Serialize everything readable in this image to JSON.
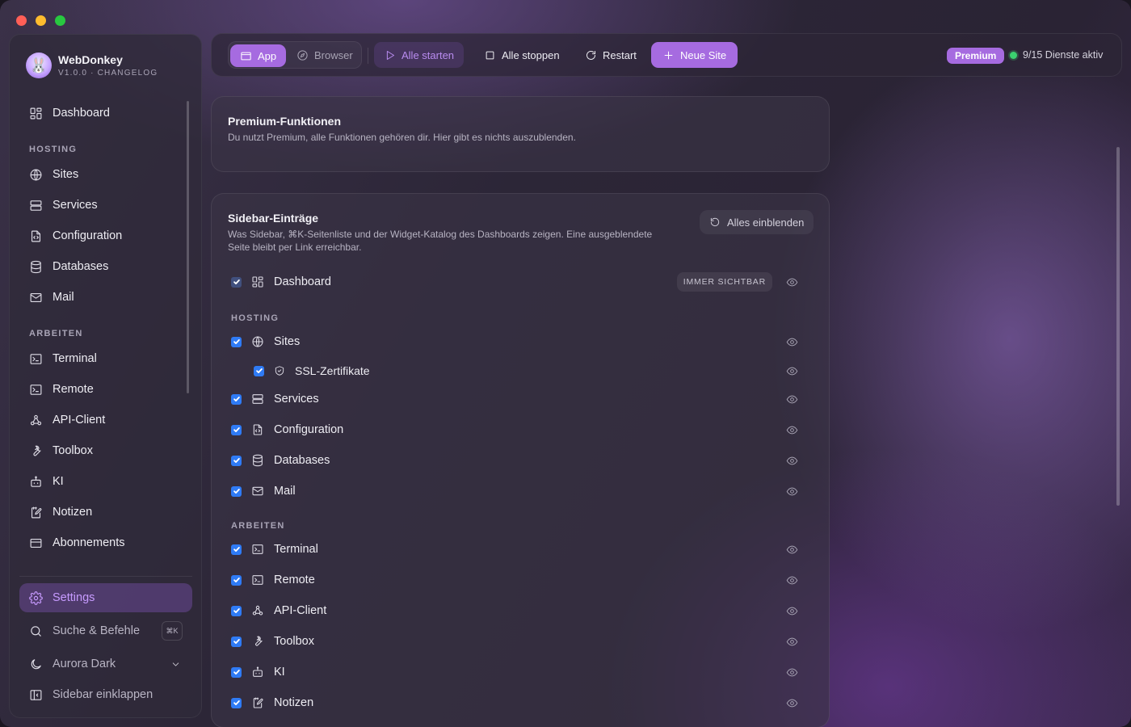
{
  "app": {
    "name": "WebDonkey",
    "version": "V1.0.0 · CHANGELOG"
  },
  "sidebar": {
    "dashboard": "Dashboard",
    "sections": {
      "hosting": "HOSTING",
      "arbeiten": "ARBEITEN"
    },
    "hosting_items": [
      "Sites",
      "Services",
      "Configuration",
      "Databases",
      "Mail"
    ],
    "arbeiten_items": [
      "Terminal",
      "Remote",
      "API-Client",
      "Toolbox",
      "KI",
      "Notizen",
      "Abonnements"
    ],
    "settings": "Settings",
    "search": "Suche & Befehle",
    "search_shortcut": "⌘K",
    "theme": "Aurora Dark",
    "collapse": "Sidebar einklappen"
  },
  "toolbar": {
    "app": "App",
    "browser": "Browser",
    "start_all": "Alle starten",
    "stop_all": "Alle stoppen",
    "restart": "Restart",
    "new_site": "Neue Site",
    "premium": "Premium",
    "status": "9/15 Dienste aktiv"
  },
  "premium_card": {
    "title": "Premium-Funktionen",
    "description": "Du nutzt Premium, alle Funktionen gehören dir. Hier gibt es nichts auszublenden."
  },
  "sidebar_card": {
    "title": "Sidebar-Einträge",
    "description_line1": "Was Sidebar, ⌘K-Seitenliste und der Widget-Katalog des Dashboards zeigen. Eine ausgeblendete",
    "description_line2": "Seite bleibt per Link erreichbar.",
    "reset_button": "Alles einblenden",
    "always_visible": "IMMER SICHTBAR",
    "dashboard": "Dashboard",
    "hosting_label": "HOSTING",
    "arbeiten_label": "ARBEITEN",
    "hosting_rows": [
      "Sites",
      "SSL-Zertifikate",
      "Services",
      "Configuration",
      "Databases",
      "Mail"
    ],
    "arbeiten_rows": [
      "Terminal",
      "Remote",
      "API-Client",
      "Toolbox",
      "KI",
      "Notizen"
    ]
  },
  "colors": {
    "accent": "#a66be0",
    "checkbox": "#2f7bf5",
    "status_ok": "#3bd16f"
  }
}
